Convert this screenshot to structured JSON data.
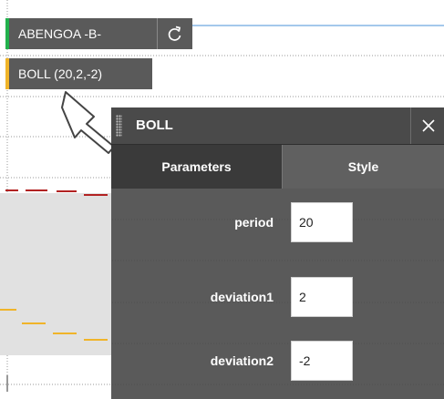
{
  "series": {
    "symbol_label": "ABENGOA -B-",
    "symbol_color": "#22b14c",
    "indicator_label": "BOLL (20,2,-2)",
    "indicator_color": "#f0b429"
  },
  "icons": {
    "refresh": "refresh-icon",
    "close": "close-icon",
    "grip": "drag-handle-icon",
    "pointer": "arrow-pointer-icon"
  },
  "panel": {
    "title": "BOLL",
    "tabs": [
      {
        "label": "Parameters",
        "active": true
      },
      {
        "label": "Style",
        "active": false
      }
    ],
    "params": [
      {
        "label": "period",
        "value": "20"
      },
      {
        "label": "deviation1",
        "value": "2"
      },
      {
        "label": "deviation2",
        "value": "-2"
      }
    ]
  },
  "colors": {
    "panel_bg": "#484848",
    "upper_band": "#b22222",
    "lower_band": "#f0b429",
    "chart_line": "#4a90d9"
  }
}
